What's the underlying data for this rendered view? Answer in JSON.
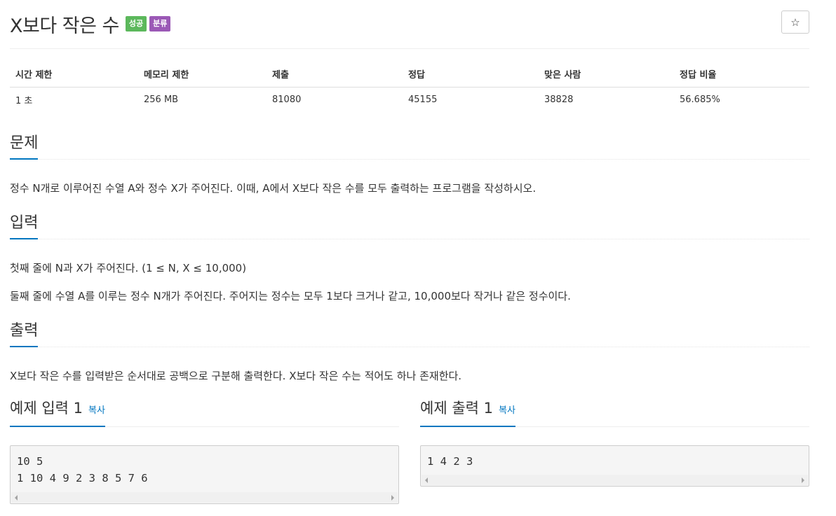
{
  "problem": {
    "title": "X보다 작은 수",
    "labels": [
      {
        "text": "성공",
        "color": "#5cb85c"
      },
      {
        "text": "분류",
        "color": "#9B59B6"
      }
    ],
    "star_icon": "☆"
  },
  "info_table": {
    "headers": [
      "시간 제한",
      "메모리 제한",
      "제출",
      "정답",
      "맞은 사람",
      "정답 비율"
    ],
    "values": [
      "1 초",
      "256 MB",
      "81080",
      "45155",
      "38828",
      "56.685%"
    ]
  },
  "sections": {
    "description": {
      "heading": "문제",
      "text": "정수 N개로 이루어진 수열 A와 정수 X가 주어진다. 이때, A에서 X보다 작은 수를 모두 출력하는 프로그램을 작성하시오."
    },
    "input": {
      "heading": "입력",
      "lines": [
        "첫째 줄에 N과 X가 주어진다. (1 ≤ N, X ≤ 10,000)",
        "둘째 줄에 수열 A를 이루는 정수 N개가 주어진다. 주어지는 정수는 모두 1보다 크거나 같고, 10,000보다 작거나 같은 정수이다."
      ]
    },
    "output": {
      "heading": "출력",
      "text": "X보다 작은 수를 입력받은 순서대로 공백으로 구분해 출력한다. X보다 작은 수는 적어도 하나 존재한다."
    }
  },
  "samples": {
    "input": {
      "heading": "예제 입력 1",
      "copy_label": "복사",
      "lines": [
        "10 5",
        "1 10 4 9 2 3 8 5 7 6"
      ]
    },
    "output": {
      "heading": "예제 출력 1",
      "copy_label": "복사",
      "lines": [
        "1 4 2 3"
      ]
    }
  },
  "colors": {
    "accent": "#0076c0",
    "success_label": "#5cb85c",
    "category_label": "#9B59B6"
  }
}
